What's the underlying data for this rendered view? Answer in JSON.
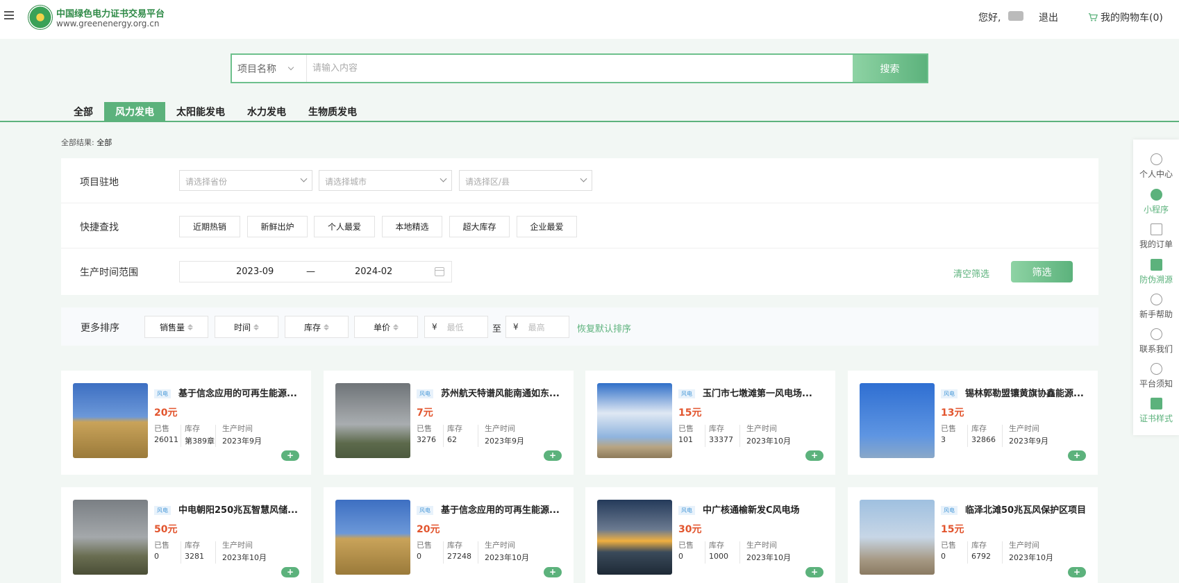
{
  "header": {
    "brand_cn": "中国绿色电力证书交易平台",
    "brand_url": "www.greenenergy.org.cn",
    "hello": "您好,",
    "logout": "退出",
    "cart": "我的购物车(0)"
  },
  "search": {
    "type": "项目名称",
    "placeholder": "请输入内容",
    "button": "搜索"
  },
  "tabs": [
    "全部",
    "风力发电",
    "太阳能发电",
    "水力发电",
    "生物质发电"
  ],
  "active_tab": "风力发电",
  "breadcrumb": {
    "label": "全部结果:",
    "value": "全部"
  },
  "filters": {
    "location_label": "项目驻地",
    "province_placeholder": "请选择省份",
    "city_placeholder": "请选择城市",
    "district_placeholder": "请选择区/县",
    "quick_label": "快捷查找",
    "quick": [
      "近期热销",
      "新鲜出炉",
      "个人最爱",
      "本地精选",
      "超大库存",
      "企业最爱"
    ],
    "date_label": "生产时间范围",
    "date_start": "2023-09",
    "date_sep": "—",
    "date_end": "2024-02",
    "clear": "清空筛选",
    "submit": "筛选"
  },
  "sort": {
    "label": "更多排序",
    "options": [
      "销售量",
      "时间",
      "库存",
      "单价"
    ],
    "yen": "¥",
    "min_placeholder": "最低",
    "to": "至",
    "max_placeholder": "最高",
    "reset": "恢复默认排序"
  },
  "product_labels": {
    "sold": "已售",
    "stock": "库存",
    "time": "生产时间",
    "add": "+"
  },
  "products": [
    {
      "tag": "风电",
      "title": "基于信念应用的可再生能源...",
      "price": "20元",
      "sold": "26011",
      "stock": "第389章",
      "time": "2023年9月"
    },
    {
      "tag": "风电",
      "title": "苏州航天特谱风能南通如东...",
      "price": "7元",
      "sold": "3276",
      "stock": "62",
      "time": "2023年9月"
    },
    {
      "tag": "风电",
      "title": "玉门市七墩滩第一风电场...",
      "price": "15元",
      "sold": "101",
      "stock": "33377",
      "time": "2023年10月"
    },
    {
      "tag": "风电",
      "title": "锡林郭勒盟镶黄旗协鑫能源...",
      "price": "13元",
      "sold": "3",
      "stock": "32866",
      "time": "2023年9月"
    },
    {
      "tag": "风电",
      "title": "中电朝阳250兆瓦智慧风储...",
      "price": "50元",
      "sold": "0",
      "stock": "3281",
      "time": "2023年10月"
    },
    {
      "tag": "风电",
      "title": "基于信念应用的可再生能源...",
      "price": "20元",
      "sold": "0",
      "stock": "27248",
      "time": "2023年10月"
    },
    {
      "tag": "风电",
      "title": "中广核通榆新发C风电场",
      "price": "30元",
      "sold": "0",
      "stock": "1000",
      "time": "2023年10月"
    },
    {
      "tag": "风电",
      "title": "临泽北滩50兆瓦风保护区项目",
      "price": "15元",
      "sold": "0",
      "stock": "6792",
      "time": "2023年10月"
    }
  ],
  "side": [
    "个人中心",
    "小程序",
    "我的订单",
    "防伪溯源",
    "新手帮助",
    "联系我们",
    "平台须知",
    "证书样式"
  ]
}
